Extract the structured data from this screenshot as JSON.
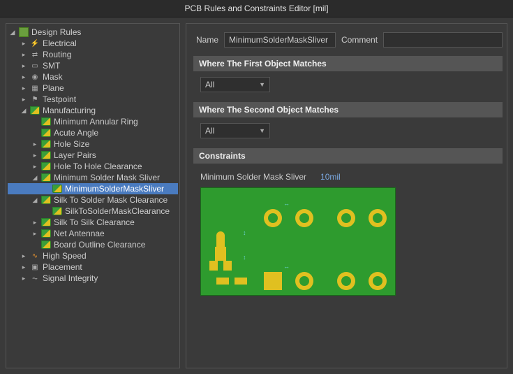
{
  "title": "PCB Rules and Constraints Editor [mil]",
  "tree": {
    "root": "Design Rules",
    "categories": [
      {
        "label": "Electrical",
        "expandable": true
      },
      {
        "label": "Routing",
        "expandable": true
      },
      {
        "label": "SMT",
        "expandable": true
      },
      {
        "label": "Mask",
        "expandable": true
      },
      {
        "label": "Plane",
        "expandable": true
      },
      {
        "label": "Testpoint",
        "expandable": true
      },
      {
        "label": "Manufacturing",
        "expandable": true,
        "expanded": true,
        "children": [
          {
            "label": "Minimum Annular Ring"
          },
          {
            "label": "Acute Angle"
          },
          {
            "label": "Hole Size",
            "expandable": true
          },
          {
            "label": "Layer Pairs",
            "expandable": true
          },
          {
            "label": "Hole To Hole Clearance",
            "expandable": true
          },
          {
            "label": "Minimum Solder Mask Sliver",
            "expandable": true,
            "expanded": true,
            "children": [
              {
                "label": "MinimumSolderMaskSliver",
                "selected": true
              }
            ]
          },
          {
            "label": "Silk To Solder Mask Clearance",
            "expandable": true,
            "expanded": true,
            "children": [
              {
                "label": "SilkToSolderMaskClearance"
              }
            ]
          },
          {
            "label": "Silk To Silk Clearance",
            "expandable": true
          },
          {
            "label": "Net Antennae",
            "expandable": true
          },
          {
            "label": "Board Outline Clearance"
          }
        ]
      },
      {
        "label": "High Speed",
        "expandable": true
      },
      {
        "label": "Placement",
        "expandable": true
      },
      {
        "label": "Signal Integrity",
        "expandable": true
      }
    ]
  },
  "form": {
    "name_label": "Name",
    "name_value": "MinimumSolderMaskSliver",
    "comment_label": "Comment",
    "comment_value": ""
  },
  "sections": {
    "first_match": "Where The First Object Matches",
    "second_match": "Where The Second Object Matches",
    "constraints": "Constraints"
  },
  "dropdowns": {
    "first_value": "All",
    "second_value": "All"
  },
  "constraint": {
    "label": "Minimum Solder Mask Sliver",
    "value": "10mil"
  }
}
